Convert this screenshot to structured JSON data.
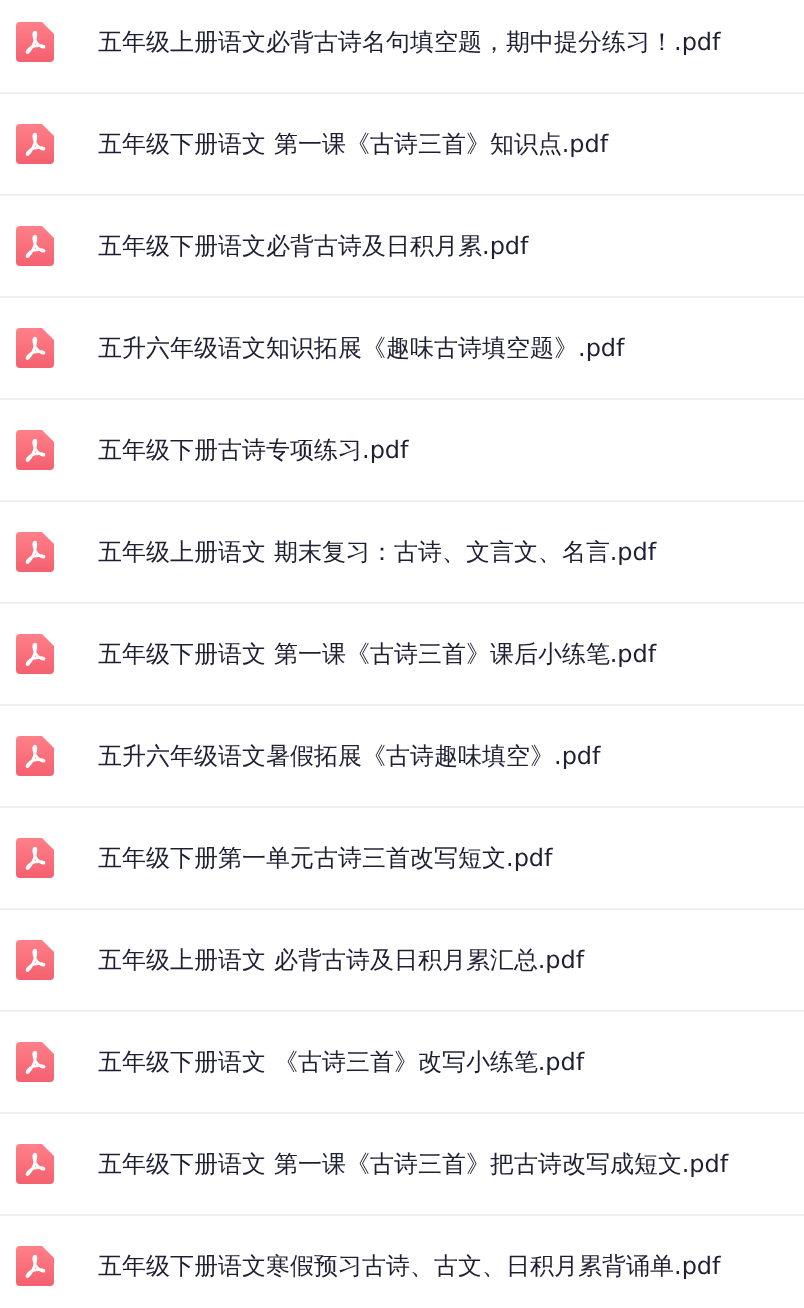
{
  "files": [
    {
      "name": "五年级上册语文必背古诗名句填空题，期中提分练习！.pdf"
    },
    {
      "name": "五年级下册语文 第一课《古诗三首》知识点.pdf"
    },
    {
      "name": "五年级下册语文必背古诗及日积月累.pdf"
    },
    {
      "name": "五升六年级语文知识拓展《趣味古诗填空题》.pdf"
    },
    {
      "name": "五年级下册古诗专项练习.pdf"
    },
    {
      "name": "五年级上册语文 期末复习：古诗、文言文、名言.pdf"
    },
    {
      "name": "五年级下册语文 第一课《古诗三首》课后小练笔.pdf"
    },
    {
      "name": "五升六年级语文暑假拓展《古诗趣味填空》.pdf"
    },
    {
      "name": "五年级下册第一单元古诗三首改写短文.pdf"
    },
    {
      "name": "五年级上册语文 必背古诗及日积月累汇总.pdf"
    },
    {
      "name": "五年级下册语文 《古诗三首》改写小练笔.pdf"
    },
    {
      "name": "五年级下册语文 第一课《古诗三首》把古诗改写成短文.pdf"
    },
    {
      "name": "五年级下册语文寒假预习古诗、古文、日积月累背诵单.pdf"
    }
  ]
}
